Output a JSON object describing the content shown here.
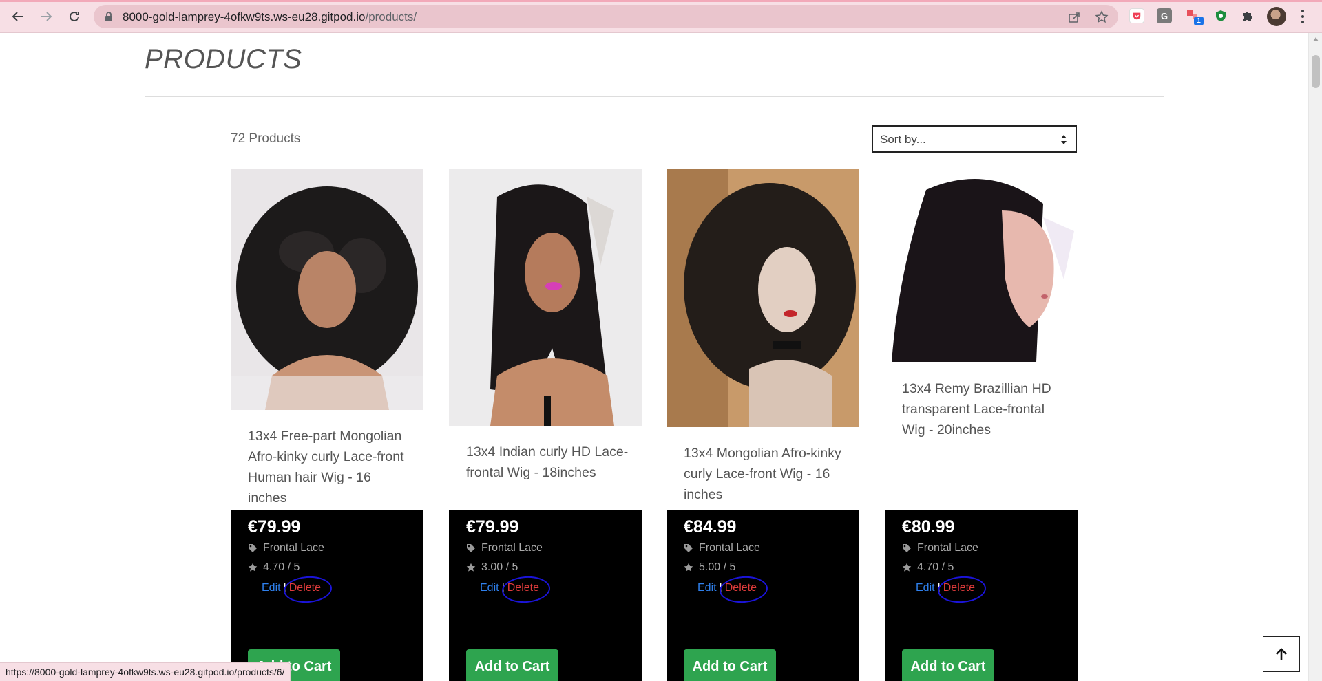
{
  "browser": {
    "url_host": "8000-gold-lamprey-4ofkw9ts.ws-eu28.gitpod.io",
    "url_path": "/products/",
    "status_url": "https://8000-gold-lamprey-4ofkw9ts.ws-eu28.gitpod.io/products/6/",
    "extensions": [
      "pocket-icon",
      "grammarly-icon",
      "extension-badge-icon",
      "shield-extension-icon",
      "puzzle-icon"
    ],
    "badge_count": "1",
    "ext_g_label": "G"
  },
  "page": {
    "title": "PRODUCTS",
    "product_count": "72 Products",
    "sort_placeholder": "Sort by..."
  },
  "products": [
    {
      "name": "13x4 Free-part Mongolian Afro-kinky curly Lace-front Human hair Wig - 16 inches",
      "price": "€79.99",
      "category": "Frontal Lace",
      "rating": "4.70 / 5",
      "edit": "Edit",
      "separator": "|",
      "delete": "Delete",
      "cart": "Add to Cart"
    },
    {
      "name": "13x4 Indian curly HD Lace-frontal Wig - 18inches",
      "price": "€79.99",
      "category": "Frontal Lace",
      "rating": "3.00 / 5",
      "edit": "Edit",
      "separator": "|",
      "delete": "Delete",
      "cart": "Add to Cart"
    },
    {
      "name": "13x4 Mongolian Afro-kinky curly Lace-front Wig - 16 inches",
      "price": "€84.99",
      "category": "Frontal Lace",
      "rating": "5.00 / 5",
      "edit": "Edit",
      "separator": "|",
      "delete": "Delete",
      "cart": "Add to Cart"
    },
    {
      "name": "13x4 Remy Brazillian HD transparent Lace-frontal Wig - 20inches",
      "price": "€80.99",
      "category": "Frontal Lace",
      "rating": "4.70 / 5",
      "edit": "Edit",
      "separator": "|",
      "delete": "Delete",
      "cart": "Add to Cart"
    }
  ],
  "colors": {
    "accent_green": "#2ea44f",
    "edit_blue": "#2f80ed",
    "delete_red": "#e23c3c",
    "annotation_blue": "#1b14d9"
  }
}
